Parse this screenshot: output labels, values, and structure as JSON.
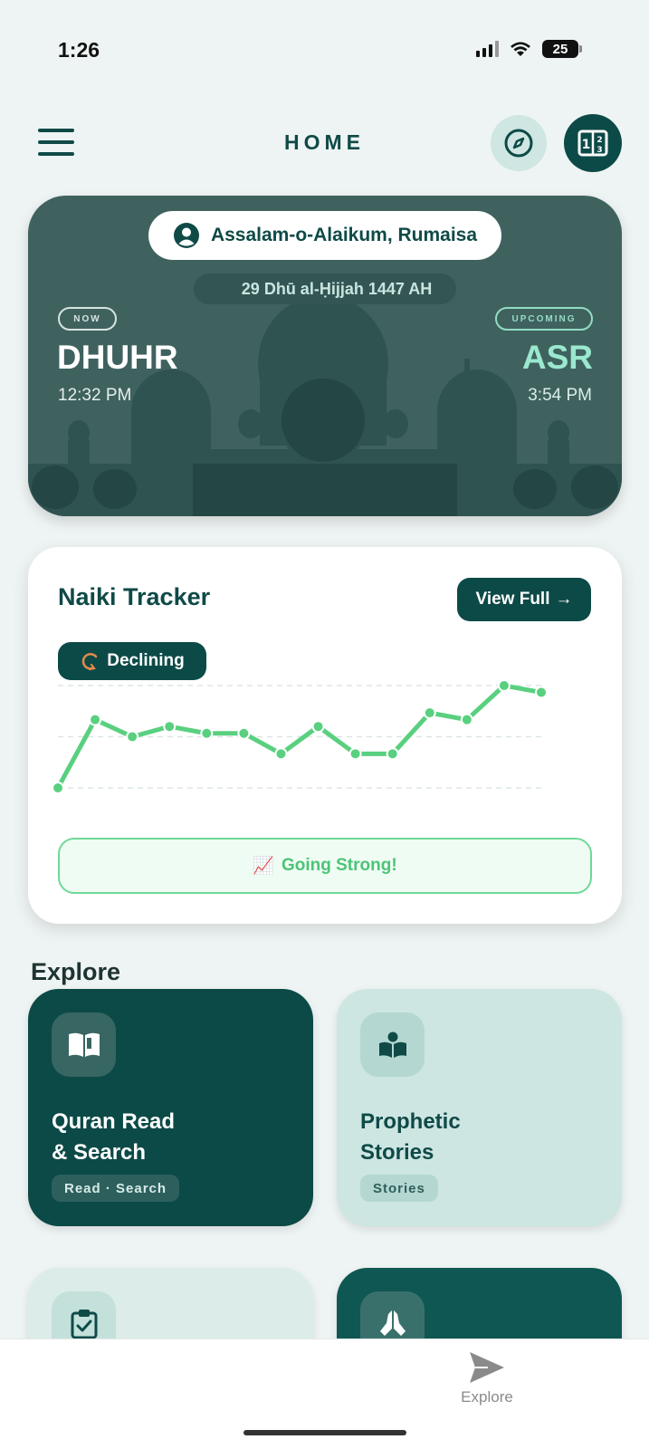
{
  "status_bar": {
    "time": "1:26",
    "battery": "25",
    "icons": [
      "signal-icon",
      "wifi-icon",
      "battery-icon"
    ]
  },
  "header": {
    "title": "HOME",
    "icons": [
      "menu-icon",
      "compass-icon",
      "calendar-icon"
    ]
  },
  "prayer_card": {
    "greeting": "Assalam-o-Alaikum, Rumaisa",
    "hijri_date": "29 Dhū al-Ḥijjah 1447 AH",
    "now": {
      "tag": "NOW",
      "name": "DHUHR",
      "time": "12:32 PM"
    },
    "upcoming": {
      "tag": "UPCOMING",
      "name": "ASR",
      "time": "3:54 PM"
    }
  },
  "tracker": {
    "title": "Naiki Tracker",
    "view_full": "View Full",
    "view_full_arrow": "→",
    "status": "Declining",
    "banner": "Going Strong!",
    "banner_icon": "📈",
    "chart_data": {
      "type": "line",
      "values": [
        1,
        3,
        2.5,
        2.8,
        2.6,
        2.6,
        2,
        2.8,
        2,
        2,
        3.2,
        3,
        4,
        3.8
      ],
      "ylim": [
        1,
        4
      ],
      "color": "#59d07f",
      "grid": true
    }
  },
  "explore": {
    "title": "Explore",
    "tiles": [
      {
        "title_line1": "Quran Read",
        "title_line2": "& Search",
        "tag": "Read · Search",
        "icon": "open-book-icon"
      },
      {
        "title_line1": "Prophetic",
        "title_line2": "Stories",
        "tag": "Stories",
        "icon": "reading-person-icon"
      },
      {
        "icon": "clipboard-check-icon"
      },
      {
        "icon": "praying-hands-icon"
      }
    ]
  },
  "bottom_nav": {
    "explore_label": "Explore",
    "icon": "send-icon"
  },
  "colors": {
    "primary": "#0c4a47",
    "accent_green": "#59d07f",
    "background": "#eef4f3"
  }
}
